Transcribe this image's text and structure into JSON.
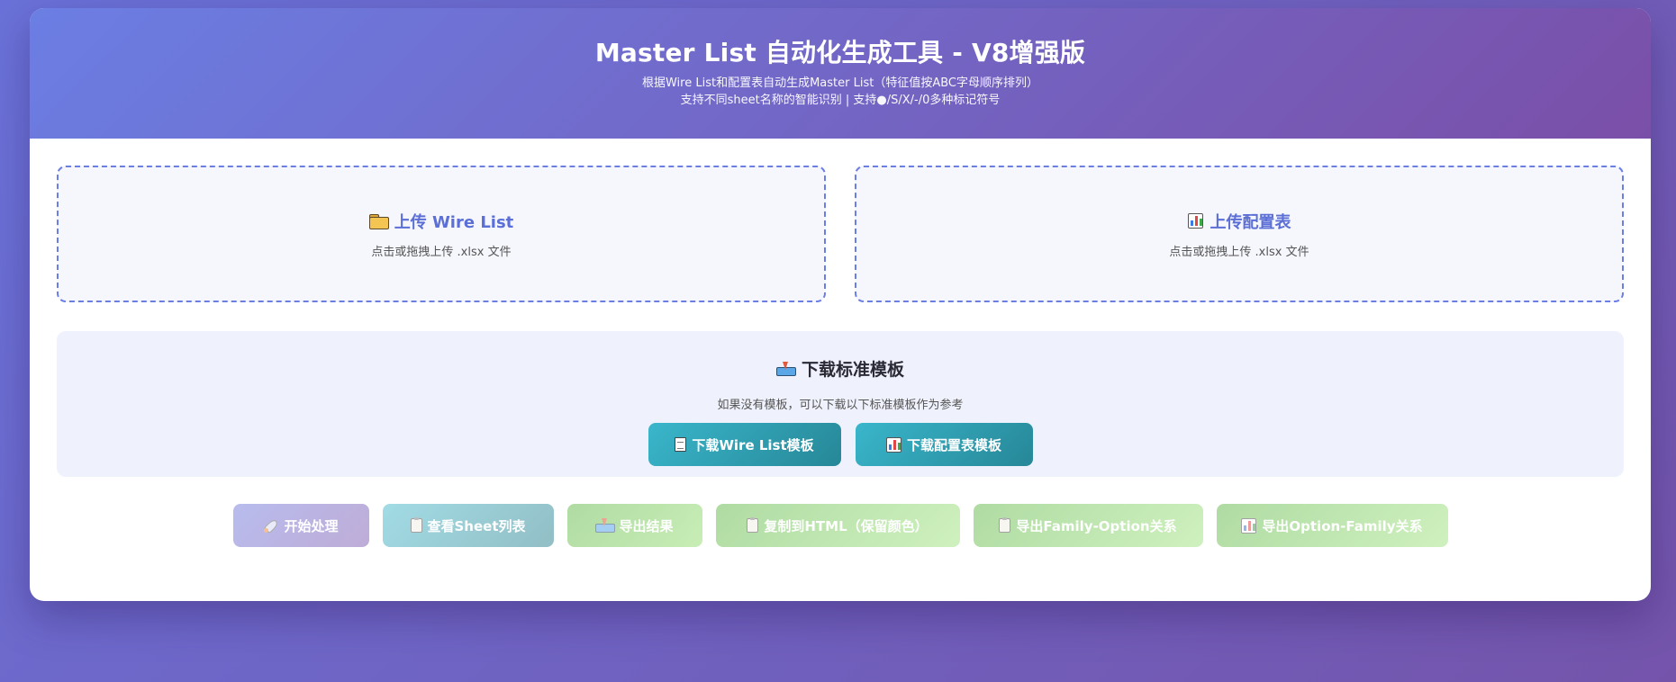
{
  "header": {
    "title": "Master List 自动化生成工具 - V8增强版",
    "subtitle_1": "根据Wire List和配置表自动生成Master List（特征值按ABC字母顺序排列）",
    "subtitle_2": "支持不同sheet名称的智能识别 | 支持●/S/X/-/0多种标记符号"
  },
  "uploads": [
    {
      "title": "上传 Wire List",
      "hint": "点击或拖拽上传 .xlsx 文件",
      "icon": "folder-icon"
    },
    {
      "title": "上传配置表",
      "hint": "点击或拖拽上传 .xlsx 文件",
      "icon": "bar-chart-icon"
    }
  ],
  "templates": {
    "title": "下载标准模板",
    "description": "如果没有模板，可以下载以下标准模板作为参考",
    "buttons": [
      {
        "label": "下载Wire List模板",
        "icon": "document-icon"
      },
      {
        "label": "下载配置表模板",
        "icon": "bar-chart-icon"
      }
    ]
  },
  "actions": [
    {
      "label": "开始处理",
      "icon": "rocket-icon",
      "enabled": false
    },
    {
      "label": "查看Sheet列表",
      "icon": "clipboard-icon",
      "enabled": false
    },
    {
      "label": "导出结果",
      "icon": "download-tray-icon",
      "enabled": false
    },
    {
      "label": "复制到HTML（保留颜色）",
      "icon": "clipboard-icon",
      "enabled": false
    },
    {
      "label": "导出Family-Option关系",
      "icon": "clipboard-icon",
      "enabled": false
    },
    {
      "label": "导出Option-Family关系",
      "icon": "bar-chart-icon",
      "enabled": false
    }
  ]
}
